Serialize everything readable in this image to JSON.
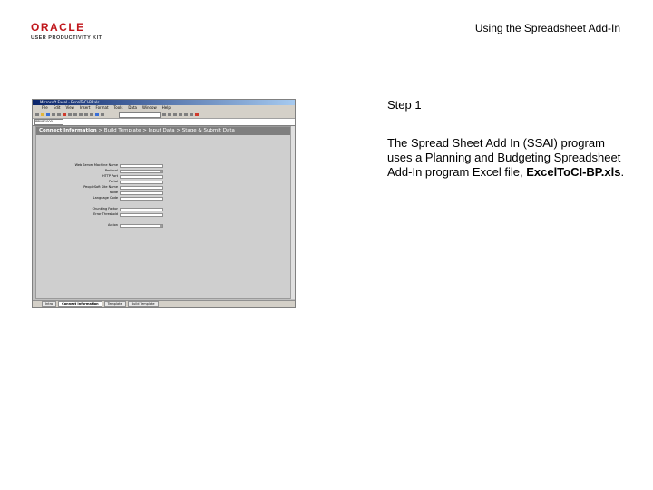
{
  "logo": {
    "word": "ORACLE",
    "sub": "USER PRODUCTIVITY KIT"
  },
  "header": {
    "title": "Using the Spreadsheet Add-In"
  },
  "step": {
    "label": "Step 1"
  },
  "description": {
    "text": "The Spread Sheet Add In (SSAI) program uses a Planning and Budgeting Spreadsheet Add-In program Excel file,",
    "filename": "ExcelToCI-BP.xls",
    "suffix": "."
  },
  "screenshot": {
    "window_title": "Microsoft Excel - ExcelToCI-BP.xls",
    "menu": [
      "File",
      "Edit",
      "View",
      "Insert",
      "Format",
      "Tools",
      "Data",
      "Window",
      "Help"
    ],
    "name_box": "PPWS1000",
    "nav": {
      "current": "Connect Information",
      "rest": " > Build Template > Input Data > Stage & Submit Data"
    },
    "fields": [
      {
        "label": "Web Server Machine Name",
        "type": "input"
      },
      {
        "label": "Protocol",
        "type": "dropdown",
        "value": "http"
      },
      {
        "label": "HTTP Port",
        "type": "input"
      },
      {
        "label": "Portal",
        "type": "input"
      },
      {
        "label": "PeopleSoft Site Name",
        "type": "input"
      },
      {
        "label": "Node",
        "type": "input"
      },
      {
        "label": "Language Code",
        "type": "input"
      }
    ],
    "fields2": [
      {
        "label": "Chunking Factor",
        "type": "input"
      },
      {
        "label": "Error Threshold",
        "type": "input"
      }
    ],
    "action": {
      "label": "Action",
      "value": "SET"
    },
    "tabs": [
      "Intro",
      "Connect Information",
      "Template",
      "Build Template"
    ]
  }
}
